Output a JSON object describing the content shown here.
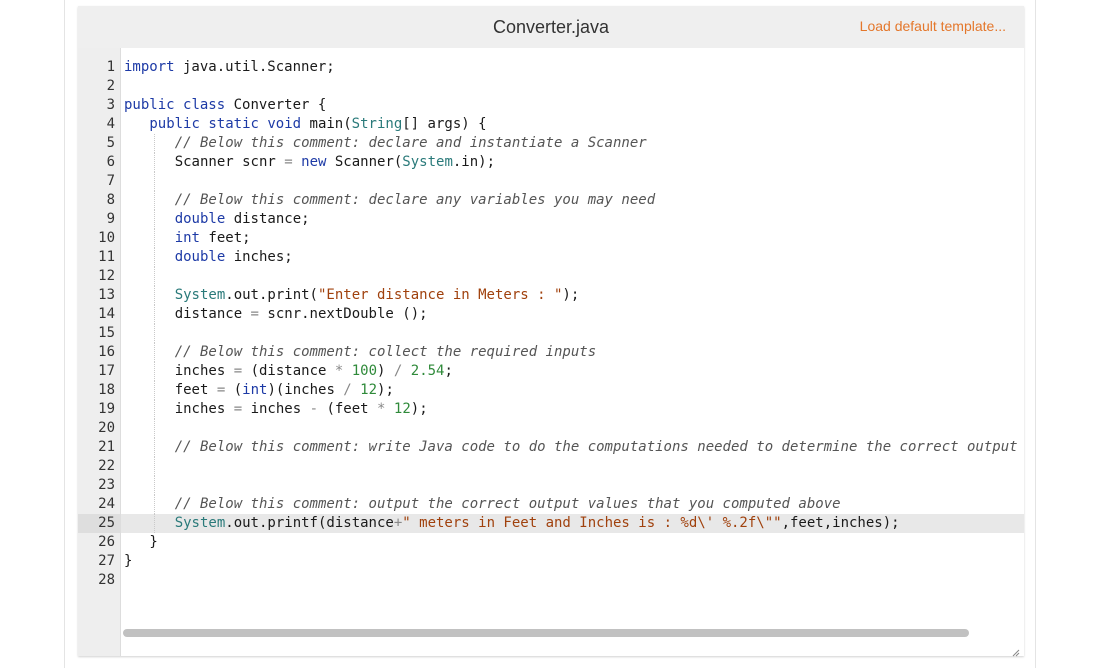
{
  "header": {
    "file_title": "Converter.java",
    "load_template_label": "Load default template..."
  },
  "colors": {
    "keyword": "#1d3aa6",
    "builtin": "#2a7a7a",
    "string": "#a0410d",
    "number": "#2f8a3a",
    "comment": "#555555",
    "operator": "#888888",
    "plain": "#1a1a1a",
    "link": "#e4772b"
  },
  "editor": {
    "active_line": 25,
    "lines": [
      {
        "n": 1,
        "indent": 0,
        "tokens": [
          [
            "k",
            "import"
          ],
          [
            "p",
            " java.util.Scanner;"
          ]
        ]
      },
      {
        "n": 2,
        "indent": 0,
        "tokens": []
      },
      {
        "n": 3,
        "indent": 0,
        "tokens": [
          [
            "k",
            "public"
          ],
          [
            "p",
            " "
          ],
          [
            "k",
            "class"
          ],
          [
            "p",
            " Converter {"
          ]
        ]
      },
      {
        "n": 4,
        "indent": 1,
        "tokens": [
          [
            "k",
            "public"
          ],
          [
            "p",
            " "
          ],
          [
            "k",
            "static"
          ],
          [
            "p",
            " "
          ],
          [
            "k",
            "void"
          ],
          [
            "p",
            " main("
          ],
          [
            "b",
            "String"
          ],
          [
            "p",
            "[] args) {"
          ]
        ]
      },
      {
        "n": 5,
        "indent": 2,
        "tokens": [
          [
            "c",
            "// Below this comment: declare and instantiate a Scanner"
          ]
        ]
      },
      {
        "n": 6,
        "indent": 2,
        "tokens": [
          [
            "p",
            "Scanner scnr "
          ],
          [
            "o",
            "="
          ],
          [
            "p",
            " "
          ],
          [
            "k",
            "new"
          ],
          [
            "p",
            " Scanner("
          ],
          [
            "b",
            "System"
          ],
          [
            "p",
            ".in);"
          ]
        ]
      },
      {
        "n": 7,
        "indent": 2,
        "tokens": []
      },
      {
        "n": 8,
        "indent": 2,
        "tokens": [
          [
            "c",
            "// Below this comment: declare any variables you may need"
          ]
        ]
      },
      {
        "n": 9,
        "indent": 2,
        "tokens": [
          [
            "k",
            "double"
          ],
          [
            "p",
            " distance;"
          ]
        ]
      },
      {
        "n": 10,
        "indent": 2,
        "tokens": [
          [
            "k",
            "int"
          ],
          [
            "p",
            " feet;"
          ]
        ]
      },
      {
        "n": 11,
        "indent": 2,
        "tokens": [
          [
            "k",
            "double"
          ],
          [
            "p",
            " inches;"
          ]
        ]
      },
      {
        "n": 12,
        "indent": 2,
        "tokens": []
      },
      {
        "n": 13,
        "indent": 2,
        "tokens": [
          [
            "b",
            "System"
          ],
          [
            "p",
            ".out.print("
          ],
          [
            "s",
            "\"Enter distance in Meters : \""
          ],
          [
            "p",
            ");"
          ]
        ]
      },
      {
        "n": 14,
        "indent": 2,
        "tokens": [
          [
            "p",
            "distance "
          ],
          [
            "o",
            "="
          ],
          [
            "p",
            " scnr.nextDouble ();"
          ]
        ]
      },
      {
        "n": 15,
        "indent": 2,
        "tokens": []
      },
      {
        "n": 16,
        "indent": 2,
        "tokens": [
          [
            "c",
            "// Below this comment: collect the required inputs"
          ]
        ]
      },
      {
        "n": 17,
        "indent": 2,
        "tokens": [
          [
            "p",
            "inches "
          ],
          [
            "o",
            "="
          ],
          [
            "p",
            " (distance "
          ],
          [
            "o",
            "*"
          ],
          [
            "p",
            " "
          ],
          [
            "n",
            "100"
          ],
          [
            "p",
            ") "
          ],
          [
            "o",
            "/"
          ],
          [
            "p",
            " "
          ],
          [
            "n",
            "2.54"
          ],
          [
            "p",
            ";"
          ]
        ]
      },
      {
        "n": 18,
        "indent": 2,
        "tokens": [
          [
            "p",
            "feet "
          ],
          [
            "o",
            "="
          ],
          [
            "p",
            " ("
          ],
          [
            "k",
            "int"
          ],
          [
            "p",
            ")(inches "
          ],
          [
            "o",
            "/"
          ],
          [
            "p",
            " "
          ],
          [
            "n",
            "12"
          ],
          [
            "p",
            ");"
          ]
        ]
      },
      {
        "n": 19,
        "indent": 2,
        "tokens": [
          [
            "p",
            "inches "
          ],
          [
            "o",
            "="
          ],
          [
            "p",
            " inches "
          ],
          [
            "o",
            "-"
          ],
          [
            "p",
            " (feet "
          ],
          [
            "o",
            "*"
          ],
          [
            "p",
            " "
          ],
          [
            "n",
            "12"
          ],
          [
            "p",
            ");"
          ]
        ]
      },
      {
        "n": 20,
        "indent": 2,
        "tokens": []
      },
      {
        "n": 21,
        "indent": 2,
        "tokens": [
          [
            "c",
            "// Below this comment: write Java code to do the computations needed to determine the correct output"
          ]
        ]
      },
      {
        "n": 22,
        "indent": 2,
        "tokens": []
      },
      {
        "n": 23,
        "indent": 2,
        "tokens": []
      },
      {
        "n": 24,
        "indent": 2,
        "tokens": [
          [
            "c",
            "// Below this comment: output the correct output values that you computed above"
          ]
        ]
      },
      {
        "n": 25,
        "indent": 2,
        "tokens": [
          [
            "b",
            "System"
          ],
          [
            "p",
            ".out.printf(distance"
          ],
          [
            "o",
            "+"
          ],
          [
            "s",
            "\" meters in Feet and Inches is : %d\\' %.2f\\\"\""
          ],
          [
            "p",
            ",feet,inches);"
          ]
        ]
      },
      {
        "n": 26,
        "indent": 1,
        "tokens": [
          [
            "p",
            "}"
          ]
        ]
      },
      {
        "n": 27,
        "indent": 0,
        "tokens": [
          [
            "p",
            "}"
          ]
        ]
      },
      {
        "n": 28,
        "indent": 0,
        "tokens": []
      }
    ]
  }
}
